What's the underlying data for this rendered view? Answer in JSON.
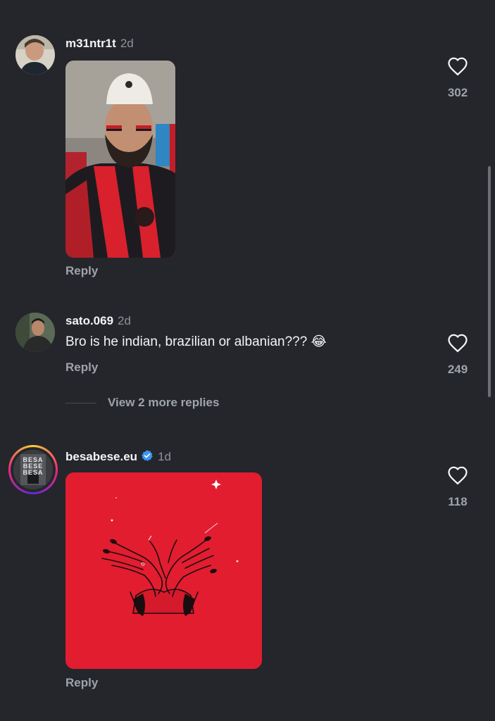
{
  "colors": {
    "background": "#25262b",
    "text": "#f3f4f6",
    "muted": "#9ea3ab",
    "verified": "#3897f0",
    "albanian_red": "#e21d30"
  },
  "comments": [
    {
      "username": "m31ntr1t",
      "time": "2d",
      "reply_label": "Reply",
      "likes": "302",
      "media": "photo-albanian-fan"
    },
    {
      "username": "sato.069",
      "time": "2d",
      "text": "Bro is he indian, brazilian or albanian???",
      "emoji": "😂",
      "reply_label": "Reply",
      "likes": "249",
      "view_more": "View 2 more replies"
    },
    {
      "username": "besabese.eu",
      "verified": true,
      "time": "1d",
      "avatar_text": [
        "BESA",
        "BESE",
        "BESA"
      ],
      "reply_label": "Reply",
      "likes": "118",
      "media": "illustration-albanian-eagle-hands"
    }
  ],
  "icons": {
    "like": "heart-outline-icon",
    "verified": "verified-badge-icon"
  }
}
